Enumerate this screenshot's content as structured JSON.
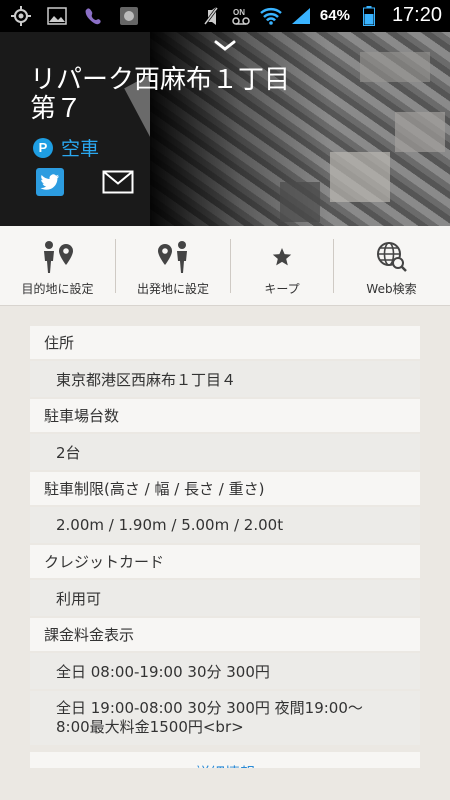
{
  "status_bar": {
    "left_icons": [
      "gps-icon",
      "image-icon",
      "viber-icon",
      "app-icon"
    ],
    "right_icons": [
      "mute-icon",
      "voicemail-icon",
      "wifi-icon",
      "signal-icon",
      "battery-icon"
    ],
    "battery": "64%",
    "time": "17:20"
  },
  "header": {
    "title": "リパーク西麻布１丁目第７",
    "vacancy_badge": "P",
    "vacancy_text": "空車",
    "share_icons": [
      "twitter-icon",
      "mail-icon"
    ]
  },
  "actions": [
    {
      "label": "目的地に設定",
      "icon": "destination-icon"
    },
    {
      "label": "出発地に設定",
      "icon": "departure-icon"
    },
    {
      "label": "キープ",
      "icon": "star-icon"
    },
    {
      "label": "Web検索",
      "icon": "web-search-icon"
    }
  ],
  "details": {
    "address_label": "住所",
    "address_value": "東京都港区西麻布１丁目４",
    "capacity_label": "駐車場台数",
    "capacity_value": "2台",
    "limits_label": "駐車制限(高さ / 幅 / 長さ / 重さ)",
    "limits_value": "2.00m / 1.90m / 5.00m / 2.00t",
    "credit_label": "クレジットカード",
    "credit_value": "利用可",
    "fee_label": "課金料金表示",
    "fee_value_1": "全日 08:00-19:00 30分 300円",
    "fee_value_2": "全日 19:00-08:00 30分 300円 夜間19:00～ 8:00最大料金1500円<br>"
  },
  "more_button": "詳細情報",
  "colors": {
    "accent": "#2aa8f0",
    "twitter": "#2c9ce0",
    "background": "#ebe8e3"
  }
}
